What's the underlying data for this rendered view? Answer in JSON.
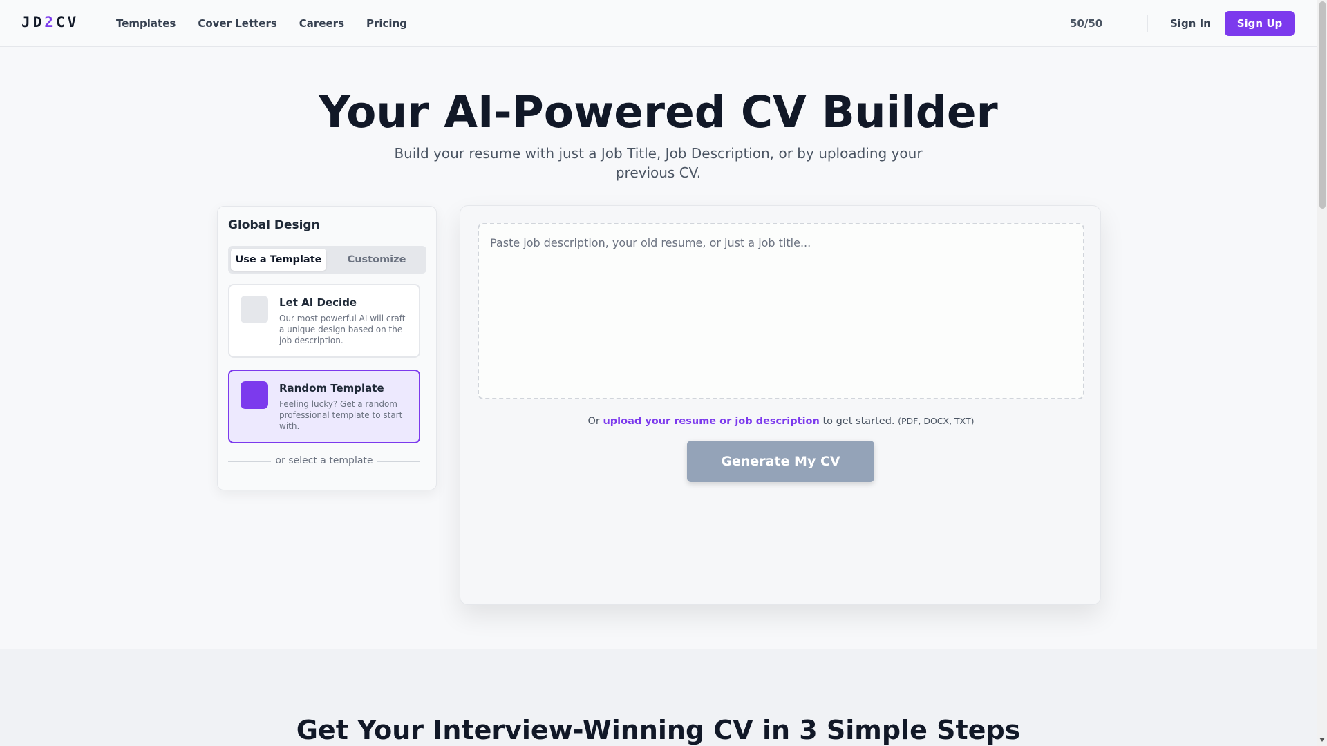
{
  "header": {
    "logo": {
      "part1": "JD",
      "part2": "2",
      "part3": "CV"
    },
    "nav": [
      "Templates",
      "Cover Letters",
      "Careers",
      "Pricing"
    ],
    "credits": "50/50",
    "sign_in": "Sign In",
    "sign_up": "Sign Up"
  },
  "hero": {
    "title": "Your AI-Powered CV Builder",
    "subtitle": "Build your resume with just a Job Title, Job Description, or by uploading your previous CV."
  },
  "design_panel": {
    "title": "Global Design",
    "tabs": [
      "Use a Template",
      "Customize"
    ],
    "active_tab": "Use a Template",
    "options": [
      {
        "title": "Let AI Decide",
        "description": "Our most powerful AI will craft a unique design based on the job description.",
        "selected": false
      },
      {
        "title": "Random Template",
        "description": "Feeling lucky? Get a random professional template to start with.",
        "selected": true
      }
    ],
    "separator": "or select a template"
  },
  "main": {
    "input_placeholder": "Paste job description, your old resume, or just a job title...",
    "input_value": "",
    "upload_prefix": "Or",
    "upload_link": "upload your resume or job description",
    "upload_suffix": "to get started.",
    "upload_formats": "(PDF, DOCX, TXT)",
    "generate_button": "Generate My CV"
  },
  "steps": {
    "title": "Get Your Interview-Winning CV in 3 Simple Steps"
  },
  "colors": {
    "accent": "#7c3aed",
    "generate_disabled": "#94a3b8",
    "selected_option_bg": "#ede9fe"
  }
}
